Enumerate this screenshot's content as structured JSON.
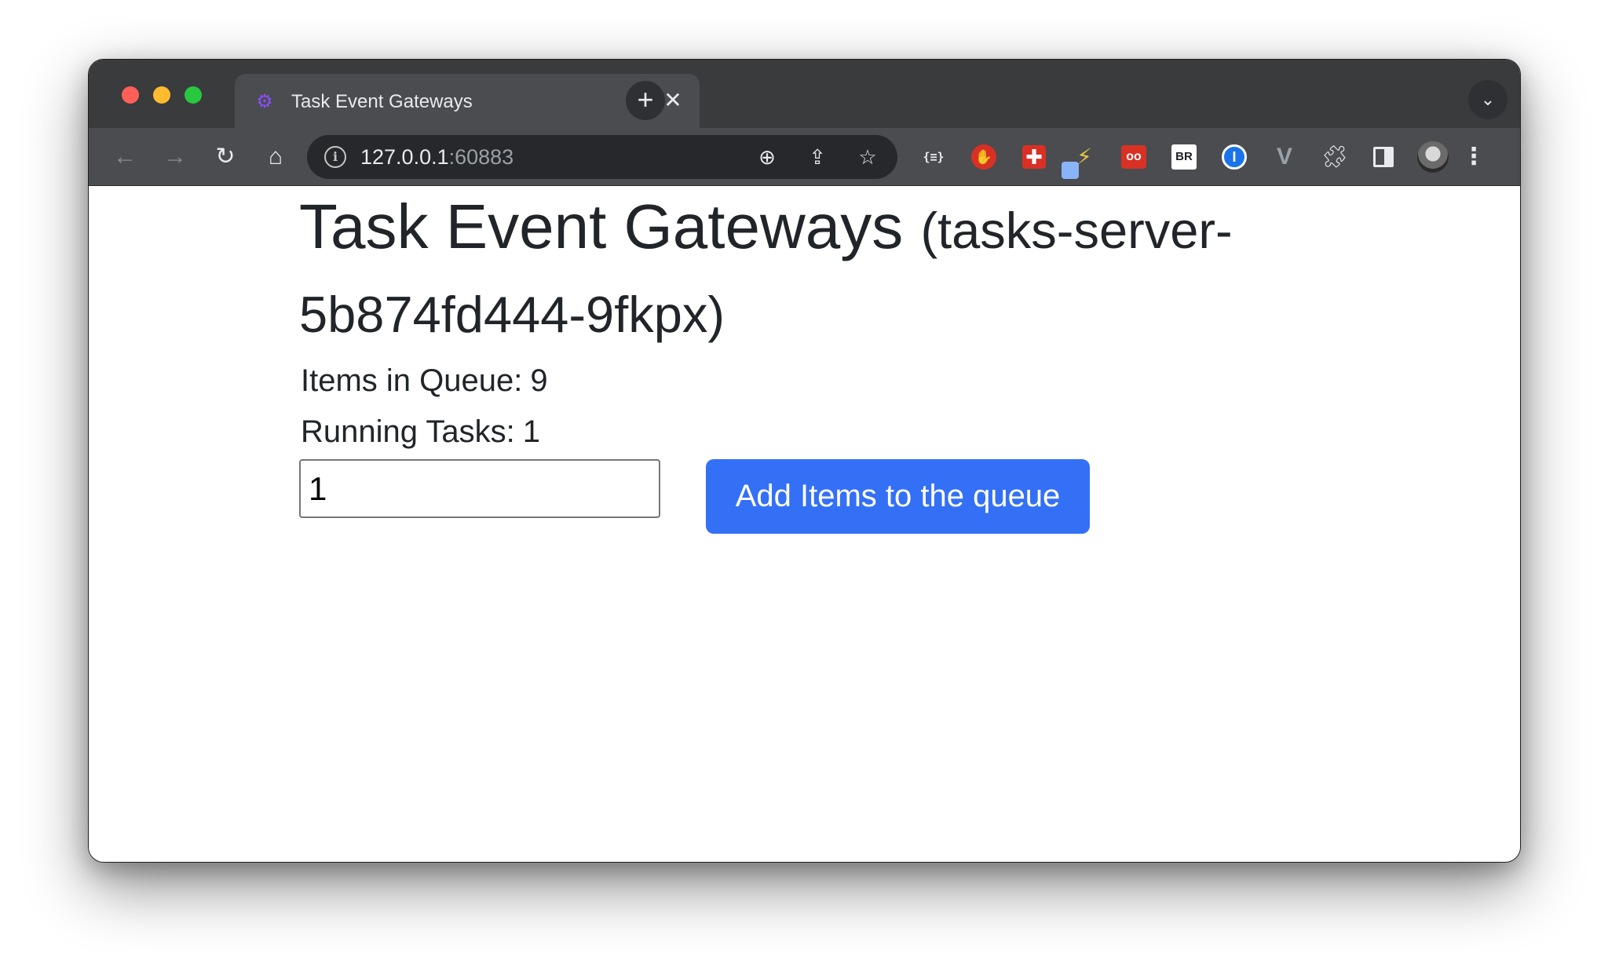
{
  "browser": {
    "tab": {
      "title": "Task Event Gateways",
      "favicon": "gears-icon",
      "close_glyph": "✕"
    },
    "new_tab_glyph": "+",
    "tab_search_glyph": "⌄",
    "address_bar": {
      "host": "127.0.0.1",
      "port": ":60883"
    },
    "extensions": {
      "json_label": "{≡}",
      "stop_label": "✋",
      "plus_label": "✚",
      "bolt_label": "⚡",
      "glasses_label": "oo",
      "br_label": "BR",
      "onepass_label": "I",
      "vue_label": "V",
      "puzzle_label": "✚"
    }
  },
  "page": {
    "title_main": "Task Event Gateways",
    "title_sub": "(tasks-server-5b874fd444-9fkpx)",
    "queue_label": "Items in Queue:",
    "queue_value": "9",
    "running_label": "Running Tasks:",
    "running_value": "1",
    "quantity_value": "1",
    "add_button_label": "Add Items to the queue"
  },
  "colors": {
    "button_bg": "#3470f6",
    "text": "#212529",
    "tab_strip": "#3a3b3d",
    "toolbar": "#4b4c4f"
  }
}
